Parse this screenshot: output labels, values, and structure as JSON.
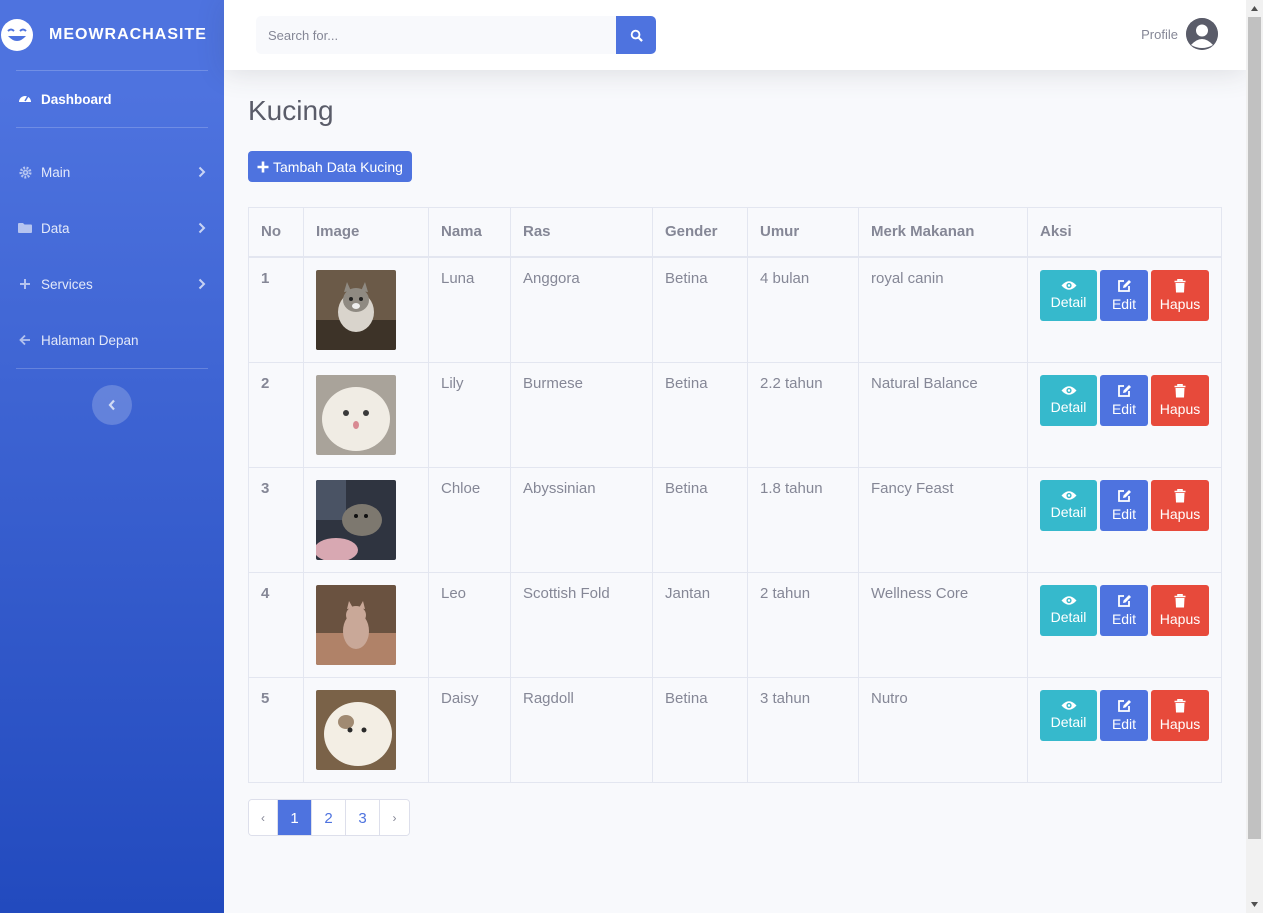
{
  "brand": {
    "name": "MEOWRACHASITE",
    "icon": "laughing-face-icon"
  },
  "sidebar": {
    "items": [
      {
        "label": "Dashboard",
        "icon": "tachometer-icon",
        "active": true
      },
      {
        "label": "Main",
        "icon": "gear-icon"
      },
      {
        "label": "Data",
        "icon": "folder-icon"
      },
      {
        "label": "Services",
        "icon": "plus-icon"
      },
      {
        "label": "Halaman Depan",
        "icon": "arrow-left-icon"
      }
    ]
  },
  "search": {
    "placeholder": "Search for..."
  },
  "profile": {
    "label": "Profile"
  },
  "page": {
    "title": "Kucing",
    "add_label": "Tambah Data Kucing"
  },
  "table": {
    "headers": [
      "No",
      "Image",
      "Nama",
      "Ras",
      "Gender",
      "Umur",
      "Merk Makanan",
      "Aksi"
    ],
    "rows": [
      {
        "no": "1",
        "nama": "Luna",
        "ras": "Anggora",
        "gender": "Betina",
        "umur": "4 bulan",
        "makanan": "royal canin"
      },
      {
        "no": "2",
        "nama": "Lily",
        "ras": "Burmese",
        "gender": "Betina",
        "umur": "2.2 tahun",
        "makanan": "Natural Balance"
      },
      {
        "no": "3",
        "nama": "Chloe",
        "ras": "Abyssinian",
        "gender": "Betina",
        "umur": "1.8 tahun",
        "makanan": "Fancy Feast"
      },
      {
        "no": "4",
        "nama": "Leo",
        "ras": "Scottish Fold",
        "gender": "Jantan",
        "umur": "2 tahun",
        "makanan": "Wellness Core"
      },
      {
        "no": "5",
        "nama": "Daisy",
        "ras": "Ragdoll",
        "gender": "Betina",
        "umur": "3 tahun",
        "makanan": "Nutro"
      }
    ],
    "actions": {
      "detail": "Detail",
      "edit": "Edit",
      "hapus": "Hapus"
    }
  },
  "pagination": {
    "prev": "‹",
    "pages": [
      "1",
      "2",
      "3"
    ],
    "next": "›",
    "active": "1"
  },
  "colors": {
    "primary": "#4e73df",
    "info": "#36b9cc",
    "danger": "#e74a3b"
  }
}
